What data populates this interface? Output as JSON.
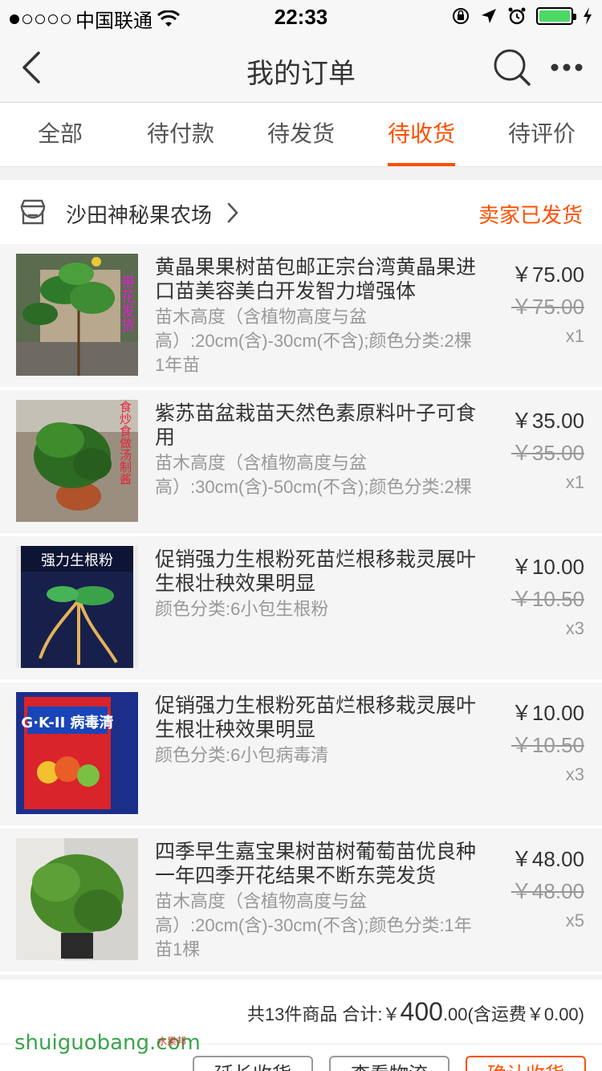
{
  "status_bar": {
    "carrier": "中国联通",
    "time": "22:33"
  },
  "nav": {
    "title": "我的订单"
  },
  "tabs": [
    {
      "label": "全部",
      "active": false
    },
    {
      "label": "待付款",
      "active": false
    },
    {
      "label": "待发货",
      "active": false
    },
    {
      "label": "待收货",
      "active": true
    },
    {
      "label": "待评价",
      "active": false
    }
  ],
  "order": {
    "shop_name": "沙田神秘果农场",
    "status": "卖家已发货",
    "items": [
      {
        "title": "黄晶果果树苗包邮正宗台湾黄晶果进口苗美容美白开发智力增强体",
        "spec": "苗木高度（含植物高度与盆高）:20cm(含)-30cm(不含);颜色分类:2棵1年苗",
        "price": "￥75.00",
        "orig_price": "￥75.00",
        "qty": "x1",
        "thumb_overlay": "带花发货"
      },
      {
        "title": "紫苏苗盆栽苗天然色素原料叶子可食用",
        "spec": "苗木高度（含植物高度与盆高）:30cm(含)-50cm(不含);颜色分类:2棵",
        "price": "￥35.00",
        "orig_price": "￥35.00",
        "qty": "x1",
        "thumb_overlay": "生食炒食做汤制酱"
      },
      {
        "title": "促销强力生根粉死苗烂根移栽灵展叶生根壮秧效果明显",
        "spec": "颜色分类:6小包生根粉",
        "price": "￥10.00",
        "orig_price": "￥10.50",
        "qty": "x3",
        "thumb_overlay": "强力生根粉"
      },
      {
        "title": "促销强力生根粉死苗烂根移栽灵展叶生根壮秧效果明显",
        "spec": "颜色分类:6小包病毒清",
        "price": "￥10.00",
        "orig_price": "￥10.50",
        "qty": "x3",
        "thumb_overlay": "G·K-II 病毒清"
      },
      {
        "title": "四季早生嘉宝果树苗树葡萄苗优良种一年四季开花结果不断东莞发货",
        "spec": "苗木高度（含植物高度与盆高）:20cm(含)-30cm(不含);颜色分类:1年苗1棵",
        "price": "￥48.00",
        "orig_price": "￥48.00",
        "qty": "x5",
        "thumb_overlay": ""
      }
    ],
    "summary_prefix": "共13件商品 合计:￥",
    "summary_total_big": "400",
    "summary_total_small": ".00",
    "summary_shipping": "(含运费￥0.00)",
    "buttons": {
      "extend": "延长收货",
      "logistics": "查看物流",
      "confirm": "确认收货"
    }
  },
  "watermark": {
    "text": "shuiguobang.com",
    "small": "水果邦"
  },
  "colors": {
    "accent": "#ff5000",
    "battery": "#4cd964"
  }
}
